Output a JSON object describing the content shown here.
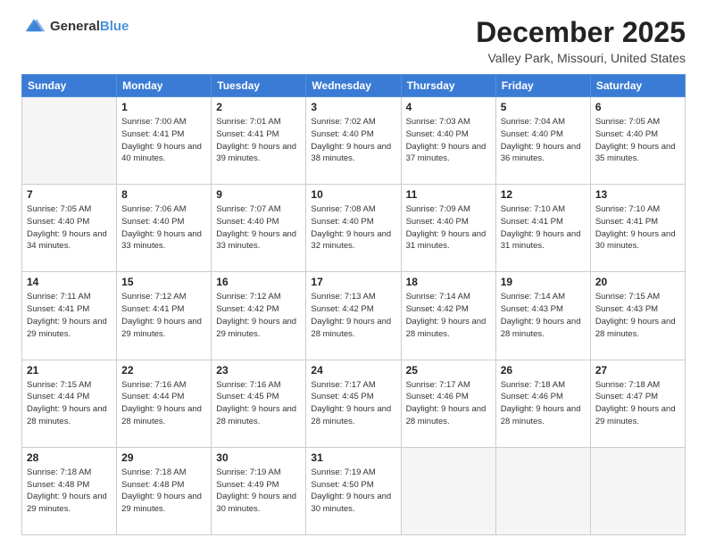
{
  "header": {
    "logo_general": "General",
    "logo_blue": "Blue",
    "month": "December 2025",
    "location": "Valley Park, Missouri, United States"
  },
  "days_of_week": [
    "Sunday",
    "Monday",
    "Tuesday",
    "Wednesday",
    "Thursday",
    "Friday",
    "Saturday"
  ],
  "weeks": [
    [
      {
        "day": "",
        "empty": true
      },
      {
        "day": "1",
        "sunrise": "7:00 AM",
        "sunset": "4:41 PM",
        "daylight": "9 hours and 40 minutes."
      },
      {
        "day": "2",
        "sunrise": "7:01 AM",
        "sunset": "4:41 PM",
        "daylight": "9 hours and 39 minutes."
      },
      {
        "day": "3",
        "sunrise": "7:02 AM",
        "sunset": "4:40 PM",
        "daylight": "9 hours and 38 minutes."
      },
      {
        "day": "4",
        "sunrise": "7:03 AM",
        "sunset": "4:40 PM",
        "daylight": "9 hours and 37 minutes."
      },
      {
        "day": "5",
        "sunrise": "7:04 AM",
        "sunset": "4:40 PM",
        "daylight": "9 hours and 36 minutes."
      },
      {
        "day": "6",
        "sunrise": "7:05 AM",
        "sunset": "4:40 PM",
        "daylight": "9 hours and 35 minutes."
      }
    ],
    [
      {
        "day": "7",
        "sunrise": "7:05 AM",
        "sunset": "4:40 PM",
        "daylight": "9 hours and 34 minutes."
      },
      {
        "day": "8",
        "sunrise": "7:06 AM",
        "sunset": "4:40 PM",
        "daylight": "9 hours and 33 minutes."
      },
      {
        "day": "9",
        "sunrise": "7:07 AM",
        "sunset": "4:40 PM",
        "daylight": "9 hours and 33 minutes."
      },
      {
        "day": "10",
        "sunrise": "7:08 AM",
        "sunset": "4:40 PM",
        "daylight": "9 hours and 32 minutes."
      },
      {
        "day": "11",
        "sunrise": "7:09 AM",
        "sunset": "4:40 PM",
        "daylight": "9 hours and 31 minutes."
      },
      {
        "day": "12",
        "sunrise": "7:10 AM",
        "sunset": "4:41 PM",
        "daylight": "9 hours and 31 minutes."
      },
      {
        "day": "13",
        "sunrise": "7:10 AM",
        "sunset": "4:41 PM",
        "daylight": "9 hours and 30 minutes."
      }
    ],
    [
      {
        "day": "14",
        "sunrise": "7:11 AM",
        "sunset": "4:41 PM",
        "daylight": "9 hours and 29 minutes."
      },
      {
        "day": "15",
        "sunrise": "7:12 AM",
        "sunset": "4:41 PM",
        "daylight": "9 hours and 29 minutes."
      },
      {
        "day": "16",
        "sunrise": "7:12 AM",
        "sunset": "4:42 PM",
        "daylight": "9 hours and 29 minutes."
      },
      {
        "day": "17",
        "sunrise": "7:13 AM",
        "sunset": "4:42 PM",
        "daylight": "9 hours and 28 minutes."
      },
      {
        "day": "18",
        "sunrise": "7:14 AM",
        "sunset": "4:42 PM",
        "daylight": "9 hours and 28 minutes."
      },
      {
        "day": "19",
        "sunrise": "7:14 AM",
        "sunset": "4:43 PM",
        "daylight": "9 hours and 28 minutes."
      },
      {
        "day": "20",
        "sunrise": "7:15 AM",
        "sunset": "4:43 PM",
        "daylight": "9 hours and 28 minutes."
      }
    ],
    [
      {
        "day": "21",
        "sunrise": "7:15 AM",
        "sunset": "4:44 PM",
        "daylight": "9 hours and 28 minutes."
      },
      {
        "day": "22",
        "sunrise": "7:16 AM",
        "sunset": "4:44 PM",
        "daylight": "9 hours and 28 minutes."
      },
      {
        "day": "23",
        "sunrise": "7:16 AM",
        "sunset": "4:45 PM",
        "daylight": "9 hours and 28 minutes."
      },
      {
        "day": "24",
        "sunrise": "7:17 AM",
        "sunset": "4:45 PM",
        "daylight": "9 hours and 28 minutes."
      },
      {
        "day": "25",
        "sunrise": "7:17 AM",
        "sunset": "4:46 PM",
        "daylight": "9 hours and 28 minutes."
      },
      {
        "day": "26",
        "sunrise": "7:18 AM",
        "sunset": "4:46 PM",
        "daylight": "9 hours and 28 minutes."
      },
      {
        "day": "27",
        "sunrise": "7:18 AM",
        "sunset": "4:47 PM",
        "daylight": "9 hours and 29 minutes."
      }
    ],
    [
      {
        "day": "28",
        "sunrise": "7:18 AM",
        "sunset": "4:48 PM",
        "daylight": "9 hours and 29 minutes."
      },
      {
        "day": "29",
        "sunrise": "7:18 AM",
        "sunset": "4:48 PM",
        "daylight": "9 hours and 29 minutes."
      },
      {
        "day": "30",
        "sunrise": "7:19 AM",
        "sunset": "4:49 PM",
        "daylight": "9 hours and 30 minutes."
      },
      {
        "day": "31",
        "sunrise": "7:19 AM",
        "sunset": "4:50 PM",
        "daylight": "9 hours and 30 minutes."
      },
      {
        "day": "",
        "empty": true
      },
      {
        "day": "",
        "empty": true
      },
      {
        "day": "",
        "empty": true
      }
    ]
  ]
}
